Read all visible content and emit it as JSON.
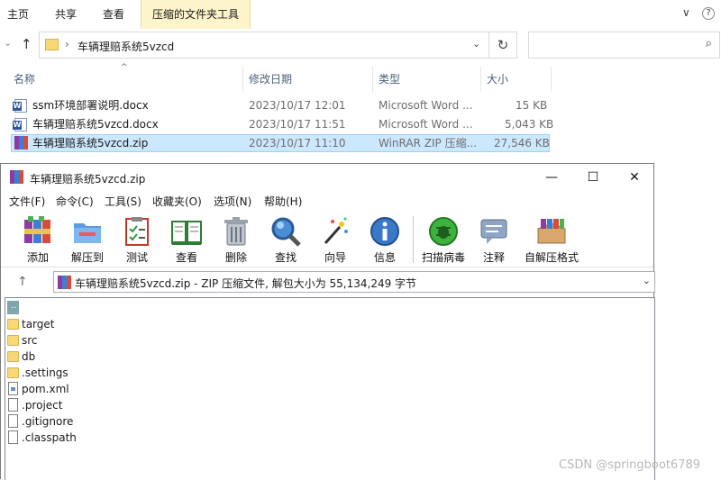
{
  "explorer": {
    "ribbon_tabs": [
      "主页",
      "共享",
      "查看",
      "压缩的文件夹工具"
    ],
    "ribbon_right": {
      "collapse": "∨",
      "help": "?"
    },
    "address": {
      "separator": "›",
      "path": "车辆理赔系统5vzcd"
    },
    "columns": {
      "name": "名称",
      "modified": "修改日期",
      "type": "类型",
      "size": "大小"
    },
    "files": [
      {
        "name": "ssm环境部署说明.docx",
        "modified": "2023/10/17 12:01",
        "type": "Microsoft Word ...",
        "size": "15 KB",
        "icon": "word-doc-icon"
      },
      {
        "name": "车辆理赔系统5vzcd.docx",
        "modified": "2023/10/17 11:51",
        "type": "Microsoft Word ...",
        "size": "5,043 KB",
        "icon": "word-doc-icon"
      },
      {
        "name": "车辆理赔系统5vzcd.zip",
        "modified": "2023/10/17 11:10",
        "type": "WinRAR ZIP 压缩...",
        "size": "27,546 KB",
        "icon": "winrar-archive-icon",
        "selected": true
      }
    ]
  },
  "winrar": {
    "title": "车辆理赔系统5vzcd.zip",
    "menu": [
      "文件(F)",
      "命令(C)",
      "工具(S)",
      "收藏夹(O)",
      "选项(N)",
      "帮助(H)"
    ],
    "toolbar": [
      "添加",
      "解压到",
      "测试",
      "查看",
      "删除",
      "查找",
      "向导",
      "信息",
      "扫描病毒",
      "注释",
      "自解压格式"
    ],
    "path_bar": "车辆理赔系统5vzcd.zip - ZIP 压缩文件, 解包大小为 55,134,249 字节",
    "entries": [
      {
        "name": "..",
        "kind": "parent"
      },
      {
        "name": "target",
        "kind": "folder"
      },
      {
        "name": "src",
        "kind": "folder"
      },
      {
        "name": "db",
        "kind": "folder"
      },
      {
        "name": ".settings",
        "kind": "folder"
      },
      {
        "name": "pom.xml",
        "kind": "xml"
      },
      {
        "name": ".project",
        "kind": "file"
      },
      {
        "name": ".gitignore",
        "kind": "file"
      },
      {
        "name": ".classpath",
        "kind": "file"
      }
    ]
  },
  "watermark": "CSDN @springboot6789",
  "colors": {
    "selection": "#cce8ff",
    "selection_border": "#99d1ff",
    "context_tab": "#fdf4c9",
    "folder": "#f8d775",
    "column_header": "#4c607a"
  }
}
